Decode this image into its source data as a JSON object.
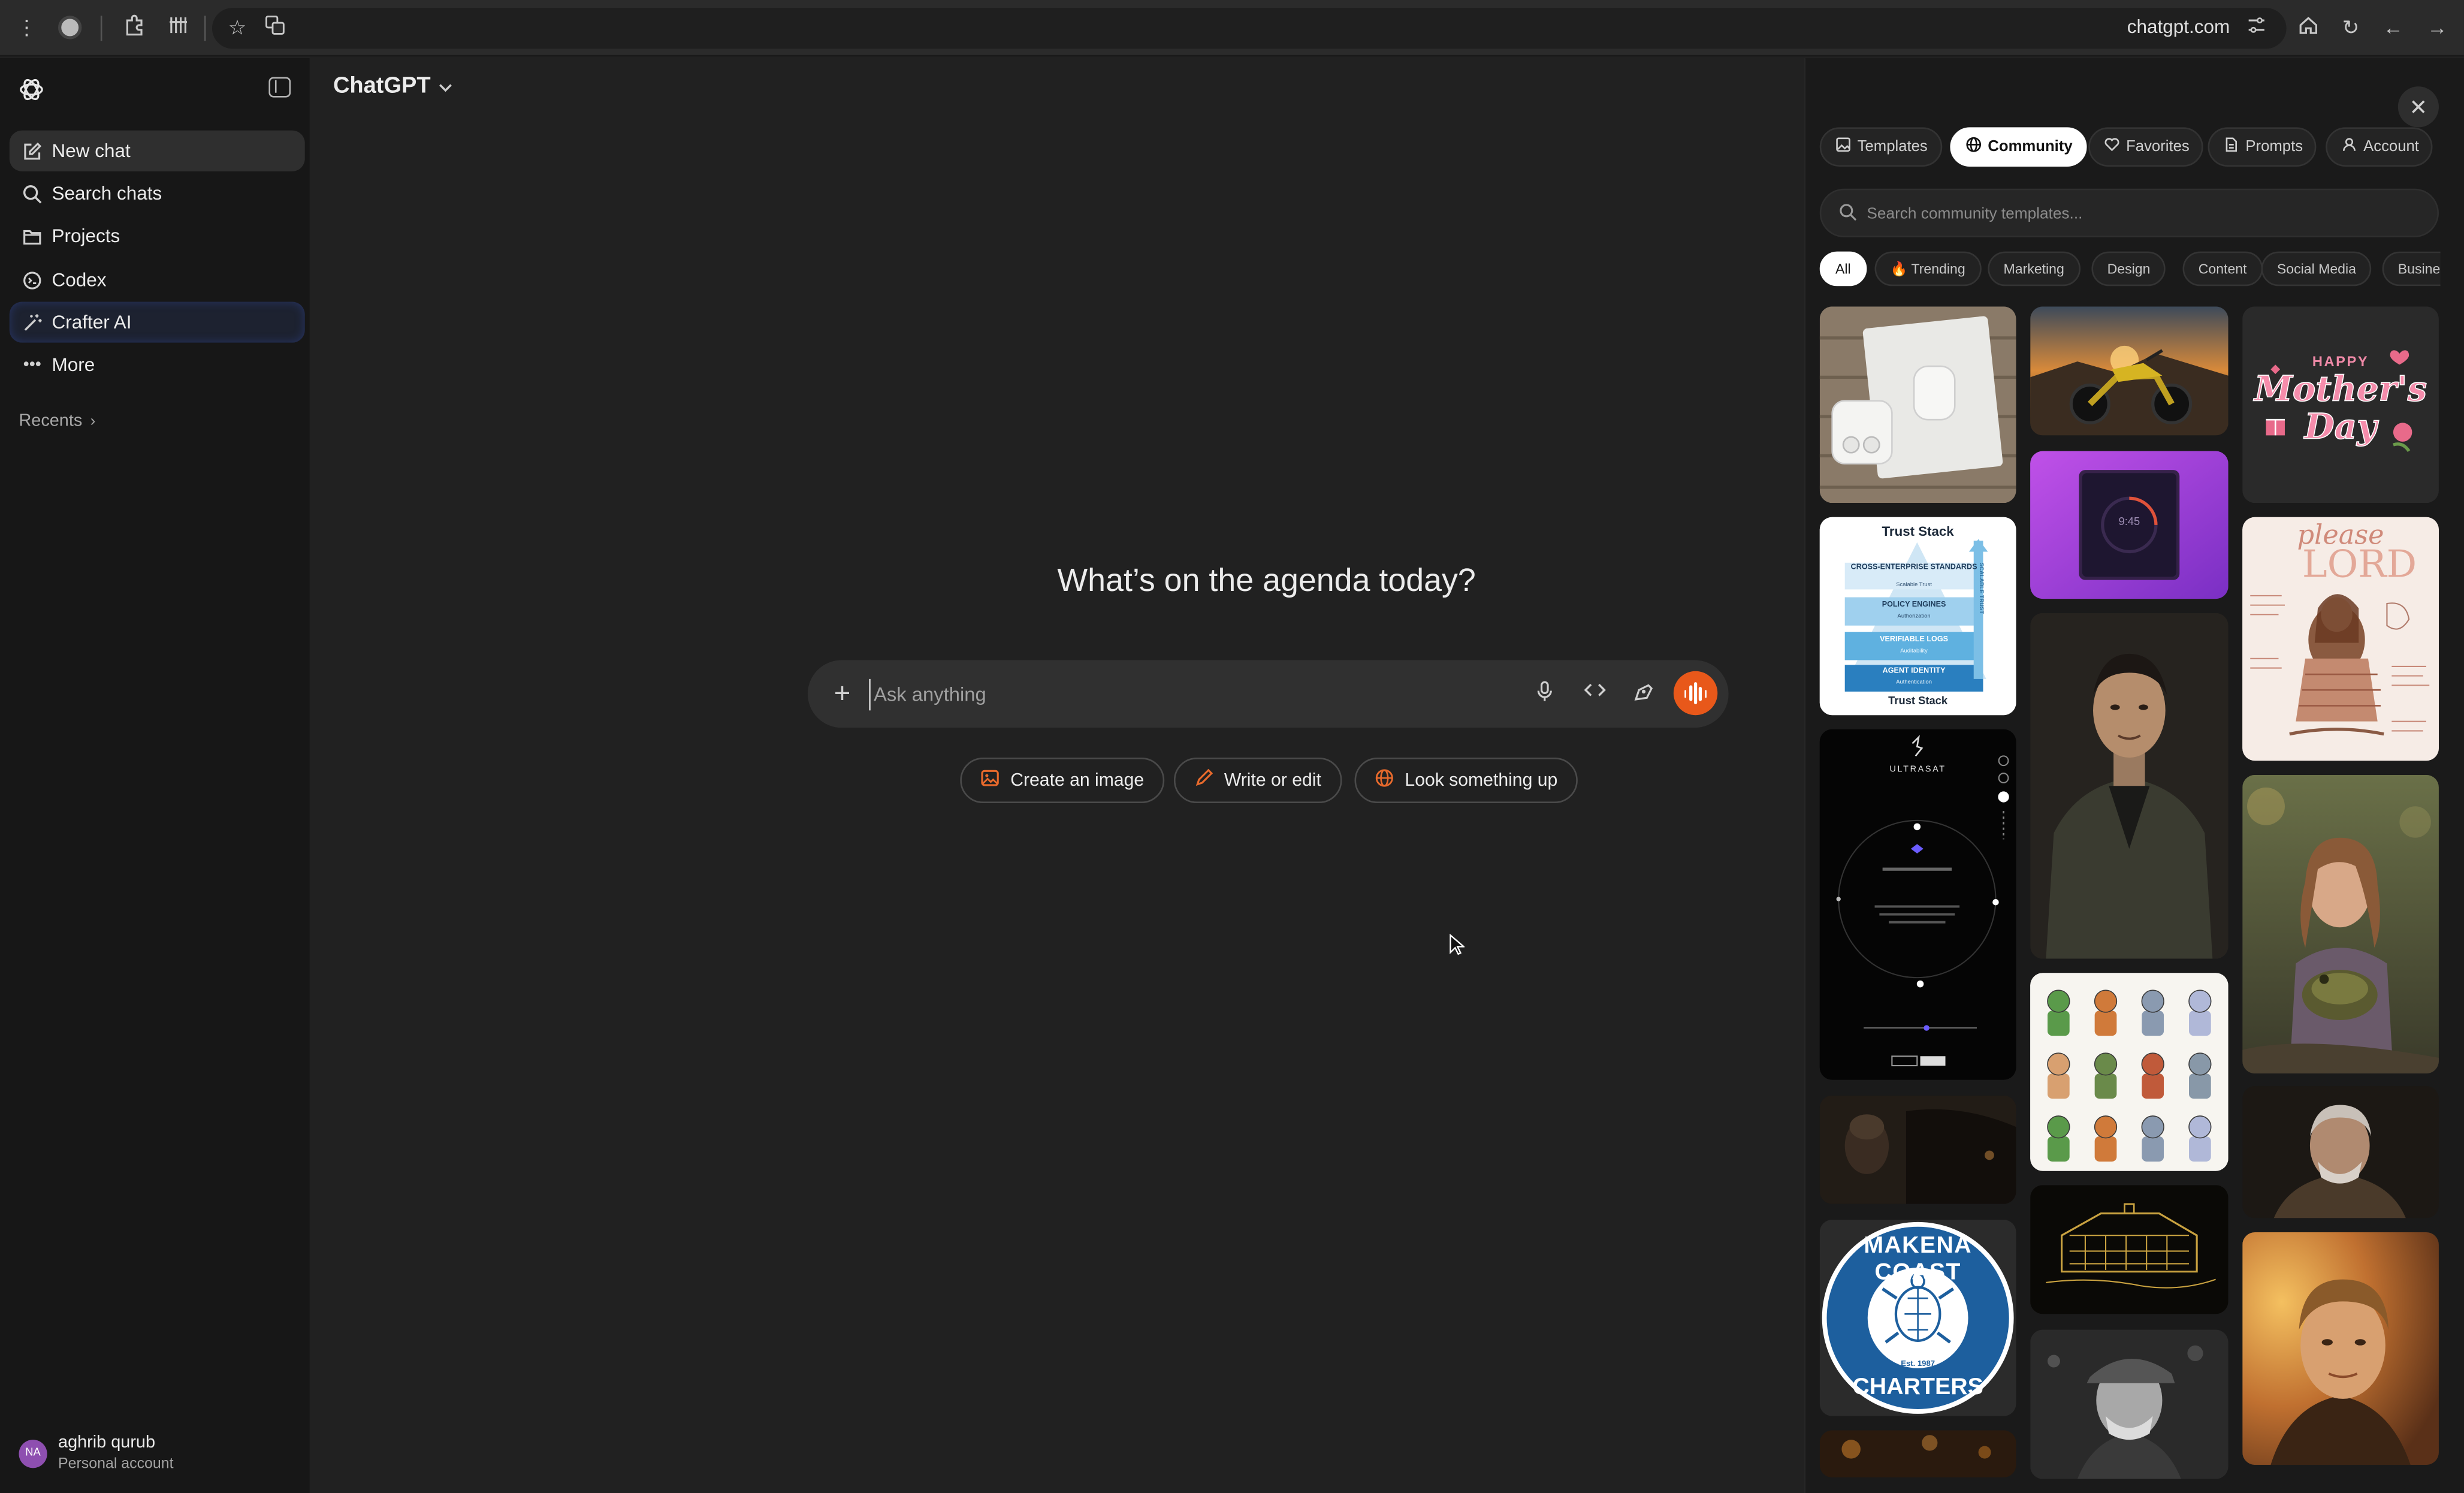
{
  "browser": {
    "url": "chatgpt.com"
  },
  "sidebar": {
    "items": [
      {
        "label": "New chat",
        "icon": "pencil-square-icon"
      },
      {
        "label": "Search chats",
        "icon": "search-icon"
      },
      {
        "label": "Projects",
        "icon": "folder-icon"
      },
      {
        "label": "Codex",
        "icon": "codex-icon"
      },
      {
        "label": "Crafter AI",
        "icon": "magic-wand-icon"
      },
      {
        "label": "More",
        "icon": "ellipsis-icon"
      }
    ],
    "recents_label": "Recents",
    "user": {
      "initials": "NA",
      "name": "aghrib qurub",
      "plan": "Personal account"
    }
  },
  "main": {
    "model_name": "ChatGPT",
    "headline": "What’s on the agenda today?",
    "composer": {
      "placeholder": "Ask anything"
    },
    "chips": [
      {
        "label": "Create an image",
        "icon": "image-icon"
      },
      {
        "label": "Write or edit",
        "icon": "pencil-icon"
      },
      {
        "label": "Look something up",
        "icon": "globe-icon"
      }
    ]
  },
  "panel": {
    "tabs": [
      {
        "label": "Templates",
        "icon": "image-icon"
      },
      {
        "label": "Community",
        "icon": "globe-icon",
        "active": true
      },
      {
        "label": "Favorites",
        "icon": "heart-icon"
      },
      {
        "label": "Prompts",
        "icon": "document-icon"
      },
      {
        "label": "Account",
        "icon": "user-icon"
      }
    ],
    "search_placeholder": "Search community templates...",
    "filters": [
      "All",
      "🔥 Trending",
      "Marketing",
      "Design",
      "Content",
      "Social Media",
      "Busine"
    ],
    "tiles": {
      "mothers_day": {
        "line1": "HAPPY",
        "line2": "Mother's",
        "line3": "Day"
      },
      "trust_stack": {
        "title": "Trust Stack",
        "layers": [
          {
            "name": "CROSS-ENTERPRISE STANDARDS",
            "sub": "Scalable Trust"
          },
          {
            "name": "POLICY ENGINES",
            "sub": "Authorization"
          },
          {
            "name": "VERIFIABLE LOGS",
            "sub": "Auditability"
          },
          {
            "name": "AGENT IDENTITY",
            "sub": "Authentication"
          }
        ],
        "footer": "Trust Stack",
        "side_label": "SCALABLE TRUST"
      },
      "timer": {
        "time": "9:45"
      },
      "please_lord": {
        "line1": "please",
        "line2": "LORD"
      },
      "ultrasat": {
        "brand": "ULTRASAT"
      },
      "makena": {
        "top": "MAKENA COAST",
        "bottom": "CHARTERS",
        "est": "Est. 1987"
      }
    }
  },
  "colors": {
    "accent_orange": "#e8581a",
    "sidebar_bg": "#171717",
    "main_bg": "#212121",
    "panel_bg": "#1a1a1a"
  }
}
